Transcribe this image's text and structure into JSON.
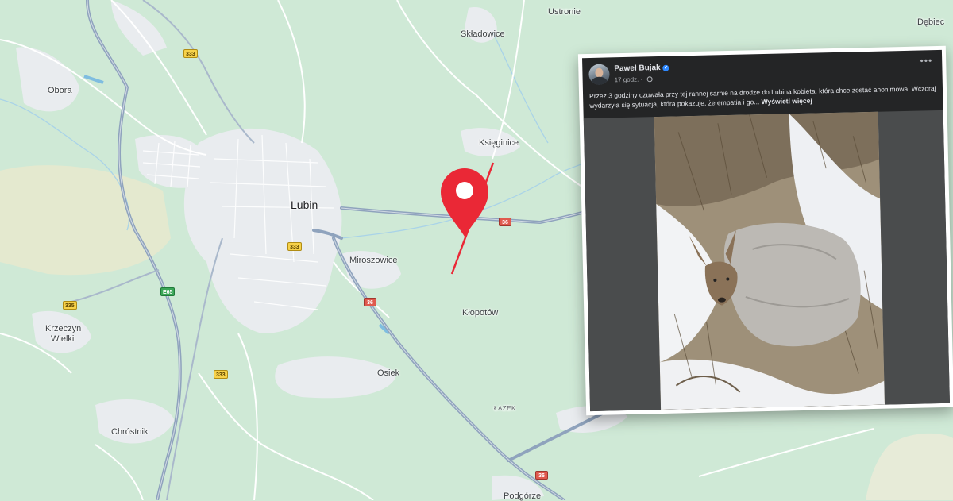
{
  "map": {
    "places": {
      "ustronie": "Ustronie",
      "debiec": "Dębiec",
      "skladowice": "Składowice",
      "obora": "Obora",
      "ksieginice": "Księginice",
      "lubin": "Lubin",
      "miroszowice": "Miroszowice",
      "klopotow": "Kłopotów",
      "krzeczyn_line1": "Krzeczyn",
      "krzeczyn_line2": "Wielki",
      "osiek": "Osiek",
      "lazek": "ŁAZEK",
      "chrostnik": "Chróstnik",
      "podgorze": "Podgórze"
    },
    "road_badges": {
      "r333_a": "333",
      "r333_b": "333",
      "r335": "335",
      "r333_c": "333",
      "s3": "E65",
      "r36_a": "36",
      "r36_b": "36",
      "r36_c": "36"
    },
    "colors": {
      "background": "#cfe9d6",
      "urban": "#e9ecef",
      "road": "#8fa3bd",
      "marker": "#ea2836"
    },
    "marker_icon": "map-pin-icon"
  },
  "post": {
    "author": "Paweł Bujak",
    "time": "17 godz.",
    "text": "Przez 3 godziny czuwała przy tej rannej sarnie na drodze do Lubina kobieta, która chce zostać anonimowa. Wczoraj wydarzyła się sytuacja, która pokazuje, że empatia i go... ",
    "see_more": "Wyświetl więcej",
    "more_icon": "more-options-icon",
    "privacy_icon": "globe-icon",
    "verified_icon": "verified-badge-icon"
  }
}
